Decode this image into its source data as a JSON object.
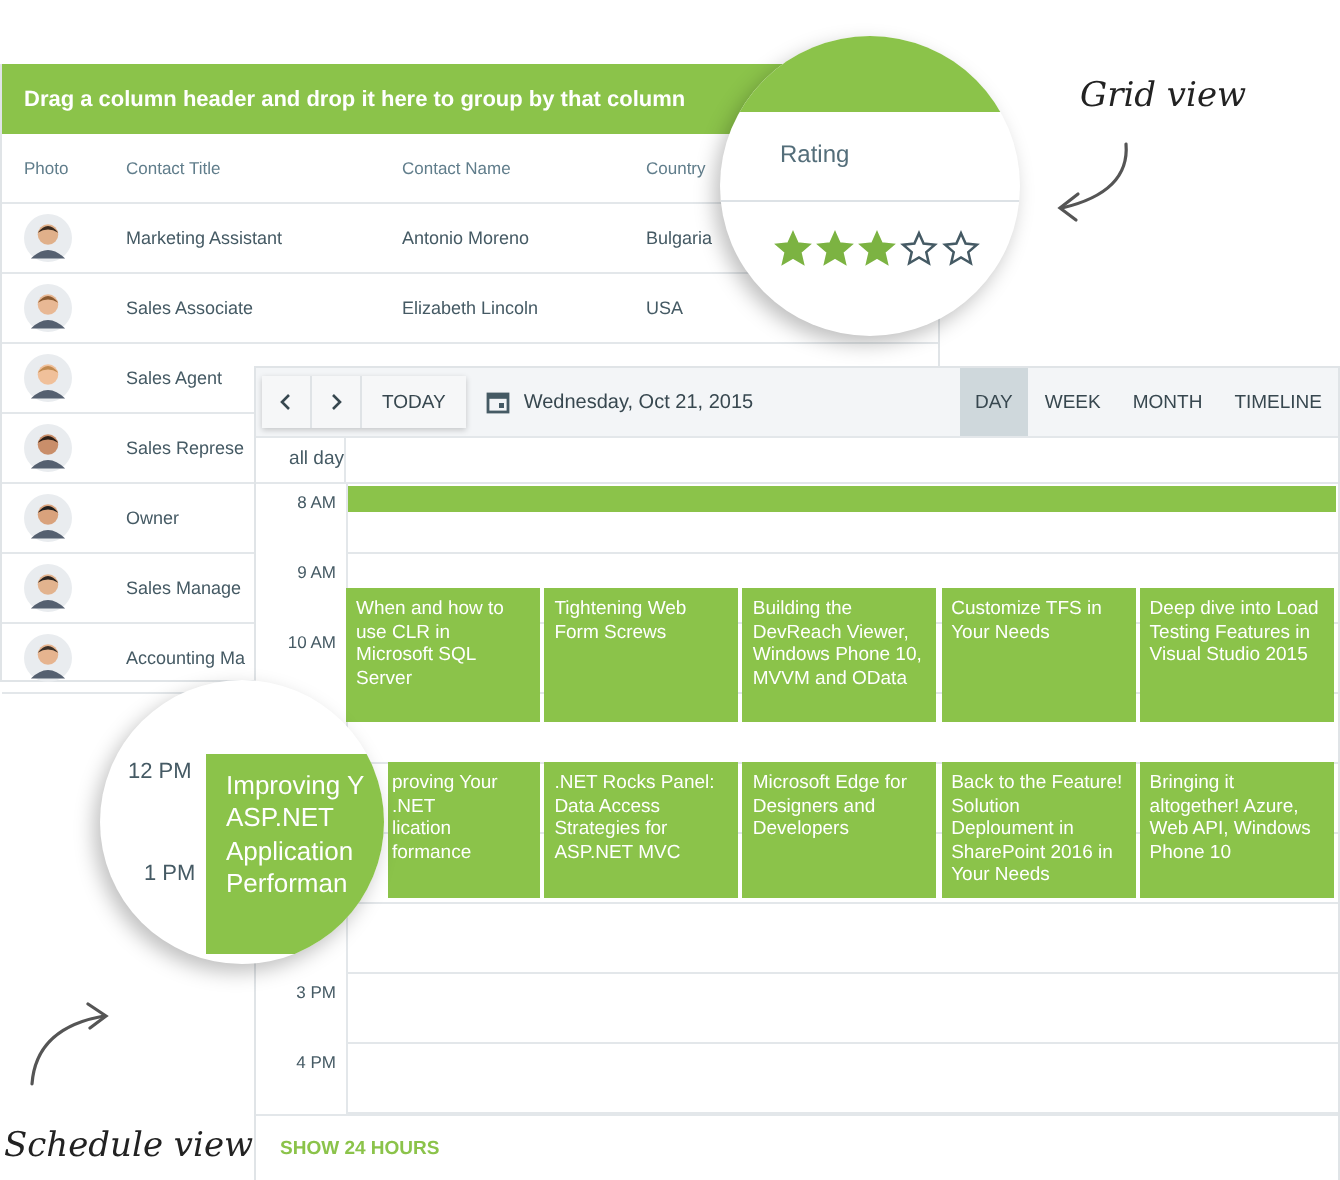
{
  "grid": {
    "group_panel": "Drag a column header and drop it here to group by that column",
    "columns": [
      "Photo",
      "Contact Title",
      "Contact Name",
      "Country"
    ],
    "rows": [
      {
        "title": "Marketing Assistant",
        "name": "Antonio Moreno",
        "country": "Bulgaria"
      },
      {
        "title": "Sales Associate",
        "name": "Elizabeth Lincoln",
        "country": "USA"
      },
      {
        "title": "Sales Agent"
      },
      {
        "title": "Sales Represe"
      },
      {
        "title": "Owner"
      },
      {
        "title": "Sales Manage"
      },
      {
        "title": "Accounting Ma"
      }
    ]
  },
  "grid_zoom": {
    "column": "Rating",
    "stars": 3
  },
  "grid_caption": "Grid view",
  "scheduler": {
    "today": "TODAY",
    "date": "Wednesday, Oct 21, 2015",
    "views": [
      {
        "label": "DAY",
        "selected": true
      },
      {
        "label": "WEEK",
        "selected": false
      },
      {
        "label": "MONTH",
        "selected": false
      },
      {
        "label": "TIMELINE",
        "selected": false
      }
    ],
    "all_day": "all day",
    "time_labels": [
      "8 AM",
      "9 AM",
      "10 AM",
      "3 PM",
      "4 PM"
    ],
    "event_rows": [
      [
        "When and how to use CLR in Microsoft SQL Server",
        "Tightening Web Form Screws",
        "Building the DevReach Viewer, Windows Phone 10, MVVM and OData",
        "Customize TFS in Your Needs",
        "Deep dive into Load Testing Features in Visual Studio 2015"
      ],
      [
        "proving Your\n.NET\nlication\nformance",
        ".NET Rocks Panel: Data Access Strategies for ASP.NET MVC",
        "Microsoft Edge for Designers and Developers",
        "Back to the Feature! Solution Deploument in SharePoint 2016 in Your Needs",
        "Bringing it altogether! Azure, Web API, Windows Phone 10"
      ]
    ],
    "footer": "SHOW 24 HOURS"
  },
  "schedule_zoom": {
    "time_labels": [
      "12 PM",
      "1 PM"
    ],
    "event": "Improving Y ASP.NET Application Performan"
  },
  "schedule_caption": "Schedule view"
}
